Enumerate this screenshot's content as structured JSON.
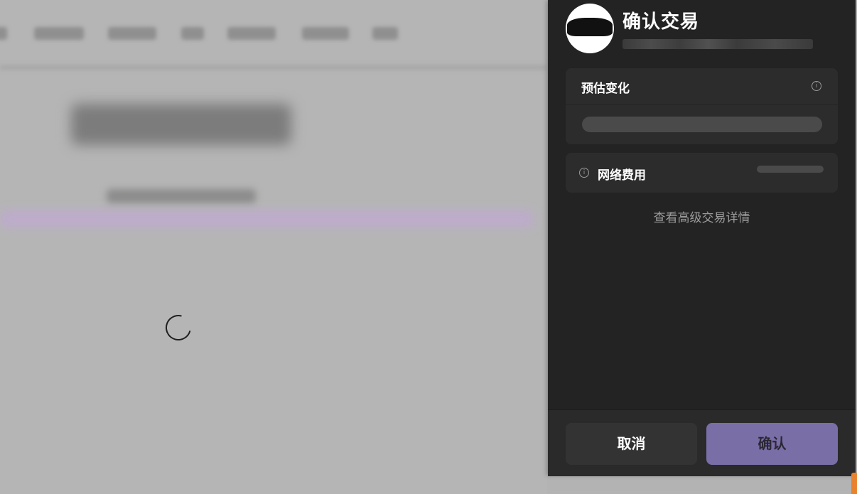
{
  "header": {
    "title": "确认交易"
  },
  "estimated_changes": {
    "label": "预估变化",
    "info_icon": "info-icon"
  },
  "network_fee": {
    "label": "网络费用",
    "info_icon": "info-icon"
  },
  "advanced_link": "查看高级交易详情",
  "footer": {
    "cancel_label": "取消",
    "confirm_label": "确认"
  },
  "colors": {
    "panel_bg": "#232323",
    "card_bg": "#2c2c2c",
    "confirm_bg": "#7a6ea6",
    "overlay_bg": "#b3b3b3"
  }
}
